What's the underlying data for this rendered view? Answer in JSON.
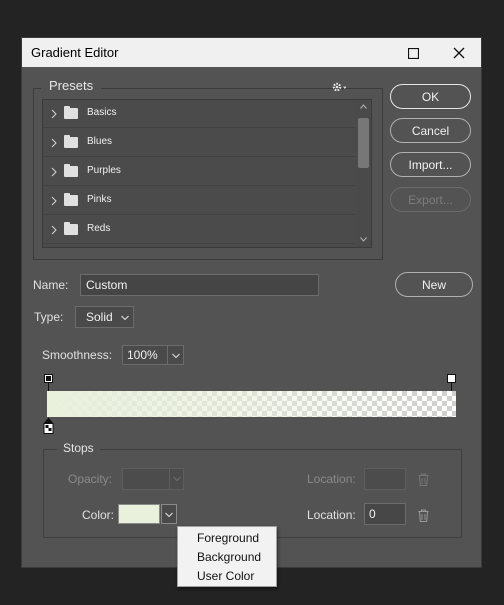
{
  "window": {
    "title": "Gradient Editor"
  },
  "presets": {
    "label": "Presets",
    "items": [
      {
        "label": "Basics"
      },
      {
        "label": "Blues"
      },
      {
        "label": "Purples"
      },
      {
        "label": "Pinks"
      },
      {
        "label": "Reds"
      }
    ]
  },
  "buttons": {
    "ok": "OK",
    "cancel": "Cancel",
    "import": "Import...",
    "export": "Export...",
    "new": "New"
  },
  "name": {
    "label": "Name:",
    "value": "Custom"
  },
  "type": {
    "label": "Type:",
    "value": "Solid"
  },
  "smoothness": {
    "label": "Smoothness:",
    "value": "100%"
  },
  "gradient": {
    "start_color": "#E9F0DC",
    "end_opacity": 0
  },
  "stops": {
    "label": "Stops",
    "opacity_label": "Opacity:",
    "opacity_location_label": "Location:",
    "color_label": "Color:",
    "color_swatch": "#E9F0DC",
    "color_location_label": "Location:",
    "color_location_value": "0"
  },
  "color_menu": {
    "items": [
      "Foreground",
      "Background",
      "User Color"
    ]
  }
}
